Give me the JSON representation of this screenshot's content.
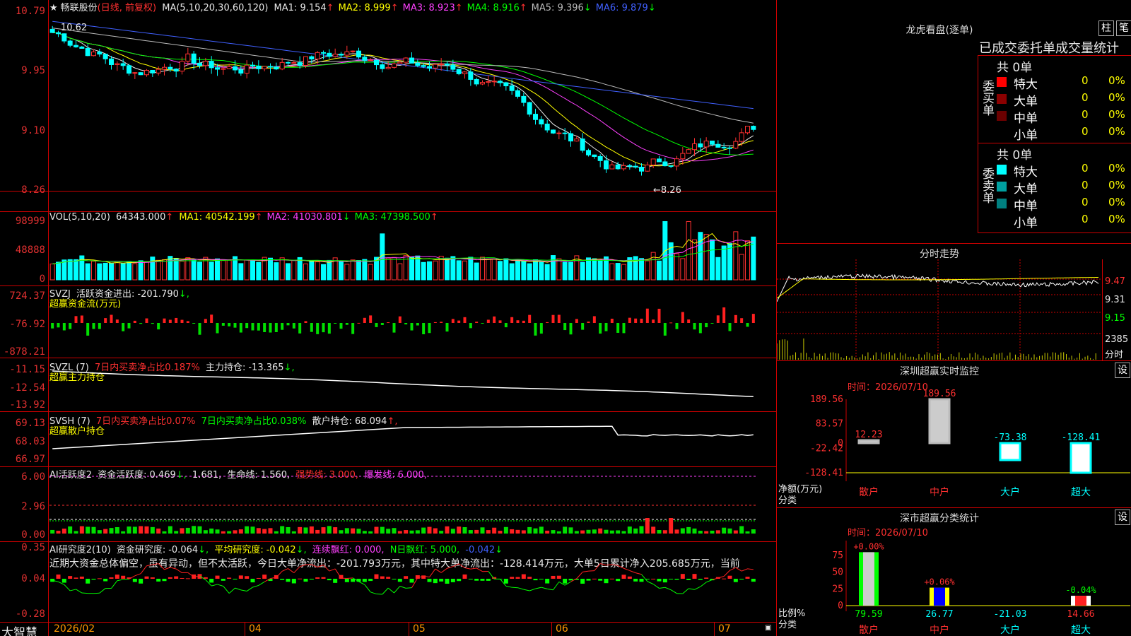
{
  "stock": {
    "name": "畅联股份",
    "period": "(日线, 前复权)"
  },
  "price_panel": {
    "ma_label": "MA(5,10,20,30,60,120)",
    "ma": [
      {
        "label": "MA1:",
        "value": "9.154",
        "arrow": "↑",
        "color": "#e8e8e8"
      },
      {
        "label": "MA2:",
        "value": "8.999",
        "arrow": "↑",
        "color": "#ffff00"
      },
      {
        "label": "MA3:",
        "value": "8.923",
        "arrow": "↑",
        "color": "#ff40ff"
      },
      {
        "label": "MA4:",
        "value": "8.916",
        "arrow": "↑",
        "color": "#00ff00"
      },
      {
        "label": "MA5:",
        "value": "9.396",
        "arrow": "↓",
        "color": "#bbbbbb"
      },
      {
        "label": "MA6:",
        "value": "9.879",
        "arrow": "↓",
        "color": "#4060ff"
      }
    ],
    "y_ticks": [
      "10.79",
      "9.95",
      "9.10",
      "8.26"
    ],
    "high_mark": "10.62",
    "low_mark": "←8.26"
  },
  "vol_panel": {
    "label": "VOL(5,10,20)",
    "value": "64343.000",
    "arrow": "↑",
    "ma": [
      {
        "label": "MA1:",
        "value": "40542.199",
        "arrow": "↑",
        "color": "#ffff00"
      },
      {
        "label": "MA2:",
        "value": "41030.801",
        "arrow": "↓",
        "color": "#ff40ff"
      },
      {
        "label": "MA3:",
        "value": "47398.500",
        "arrow": "↑",
        "color": "#00ff00"
      }
    ],
    "y_ticks": [
      "98999",
      "48888",
      "0"
    ]
  },
  "svzj_panel": {
    "label": "SVZJ",
    "line1": "活跃资金进出:",
    "value": "-201.790",
    "arrow": "↓,",
    "line2": "超赢资金流(万元)",
    "y_ticks": [
      "724.37",
      "-76.92",
      "-878.21"
    ]
  },
  "svzl_panel": {
    "label": "SVZL (7)",
    "txt1": "7日内买卖净占比0.187%",
    "txt2": "主力持仓:",
    "value": "-13.365",
    "arrow": "↓,",
    "line2": "超赢主力持仓",
    "y_ticks": [
      "-11.15",
      "-12.54",
      "-13.92"
    ]
  },
  "svsh_panel": {
    "label": "SVSH (7)",
    "txt1": "7日内买卖净占比0.07%",
    "txt2": "7日内买卖净占比0.038%",
    "txt3": "散户持仓:",
    "value": "68.094",
    "arrow": "↑,",
    "line2": "超赢散户持仓",
    "y_ticks": [
      "69.13",
      "68.03",
      "66.97"
    ]
  },
  "ai_active_panel": {
    "label": "AI活跃度2",
    "t1": "资金活跃度:",
    "v1": "0.469",
    "a1": "↓,",
    "v2": "1.681,",
    "t3": "生命线:",
    "v3": "1.560,",
    "t4": "强势线:",
    "v4": "3.000,",
    "t5": "爆发线:",
    "v5": "6.000,",
    "y_ticks": [
      "6.00",
      "2.96",
      "0.00"
    ]
  },
  "ai_research_panel": {
    "label": "AI研究度2(10)",
    "t1": "资金研究度:",
    "v1": "-0.064",
    "a1": "↓,",
    "t2": "平均研究度:",
    "v2": "-0.042",
    "a2": "↓,",
    "t3": "连续飘红:",
    "v3": "0.000,",
    "t4": "N日飘红:",
    "v4": "5.000,",
    "v5": "-0.042",
    "a5": "↓",
    "commentary": "近期大资金总体偏空，虽有异动，但不太活跃，今日大单净流出：-201.793万元，其中特大单净流出：-128.414万元，大单5日累计净入205.685万元，当前",
    "y_ticks": [
      "0.35",
      "0.04",
      "-0.28"
    ]
  },
  "bottom_bar": {
    "brand": "大智慧",
    "dates": [
      "2026/02",
      "04",
      "05",
      "06",
      "07"
    ]
  },
  "dragon_tiger": {
    "title": "龙虎看盘(逐单)",
    "btn1": "柱",
    "btn2": "笔",
    "header": "已成交委托单成交量统计",
    "buy": {
      "side_label": "委买单",
      "total": "共 0单",
      "rows": [
        {
          "label": "特大",
          "count": "0",
          "pct": "0%",
          "color": "#ff0000"
        },
        {
          "label": "大单",
          "count": "0",
          "pct": "0%",
          "color": "#8b0000"
        },
        {
          "label": "中单",
          "count": "0",
          "pct": "0%",
          "color": "#6a0000"
        },
        {
          "label": "小单",
          "count": "0",
          "pct": "0%",
          "color": ""
        }
      ]
    },
    "sell": {
      "side_label": "委卖单",
      "total": "共 0单",
      "rows": [
        {
          "label": "特大",
          "count": "0",
          "pct": "0%",
          "color": "#00ffff"
        },
        {
          "label": "大单",
          "count": "0",
          "pct": "0%",
          "color": "#00a0a0"
        },
        {
          "label": "中单",
          "count": "0",
          "pct": "0%",
          "color": "#008080"
        },
        {
          "label": "小单",
          "count": "0",
          "pct": "0%",
          "color": ""
        }
      ]
    }
  },
  "intraday": {
    "title": "分时走势",
    "price_ticks": [
      "9.47",
      "9.31",
      "9.15"
    ],
    "vol_ticks": [
      "2385",
      "分时"
    ]
  },
  "sz_monitor": {
    "title": "深圳超赢实时监控",
    "btn": "设",
    "time_label": "时间：2026/07/10",
    "y_ticks": [
      "189.56",
      "83.57",
      "0",
      "-22.42",
      "-128.41"
    ],
    "y_caption": "净额(万元)",
    "x_caption": "分类",
    "chart_data": {
      "type": "bar",
      "categories": [
        "散户",
        "中户",
        "大户",
        "超大"
      ],
      "values": [
        12.23,
        189.56,
        -73.38,
        -128.41
      ],
      "labels": [
        "12.23",
        "189.56",
        "-73.38",
        "-128.41"
      ],
      "ylim": [
        -128.41,
        189.56
      ]
    }
  },
  "sz_classify": {
    "title": "深市超赢分类统计",
    "btn": "设",
    "time_label": "时间：2026/07/10",
    "y_ticks": [
      "75",
      "50",
      "25",
      "0"
    ],
    "y_caption": "比例%",
    "x_caption": "分类",
    "chart_data": {
      "type": "bar",
      "categories": [
        "散户",
        "中户",
        "大户",
        "超大"
      ],
      "values": [
        79.59,
        26.77,
        -21.03,
        14.66
      ],
      "change_labels": [
        "+0.00%",
        "+0.06%",
        "",
        "-0.04%"
      ],
      "value_labels": [
        "79.59",
        "26.77",
        "-21.03",
        "14.66"
      ],
      "ylim": [
        0,
        80
      ]
    }
  }
}
